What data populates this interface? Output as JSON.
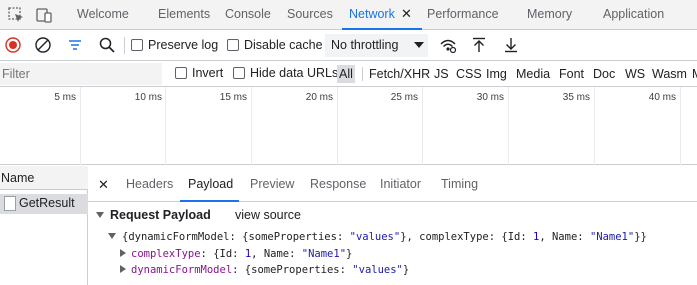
{
  "tabbar": {
    "tabs": [
      "Welcome",
      "Elements",
      "Console",
      "Sources",
      "Network",
      "Performance",
      "Memory",
      "Application"
    ],
    "active_tab": "Network",
    "close_glyph": "✕",
    "accent_color": "#1a73e8"
  },
  "toolbar": {
    "icons": [
      "record-icon",
      "clear-icon",
      "filter-icon",
      "search-icon",
      "network-conditions-icon",
      "import-har-icon",
      "export-har-icon"
    ],
    "preserve_log_label": "Preserve log",
    "disable_cache_label": "Disable cache",
    "throttling_value": "No throttling",
    "record_color": "#d93025"
  },
  "filterbar": {
    "placeholder": "Filter",
    "invert_label": "Invert",
    "hide_data_urls_label": "Hide data URLs",
    "types": [
      "All",
      "Fetch/XHR",
      "JS",
      "CSS",
      "Img",
      "Media",
      "Font",
      "Doc",
      "WS",
      "Wasm",
      "M"
    ],
    "selected_type": "All"
  },
  "timeline": {
    "ticks": [
      "5 ms",
      "10 ms",
      "15 ms",
      "20 ms",
      "25 ms",
      "30 ms",
      "35 ms",
      "40 ms"
    ]
  },
  "requests": {
    "header": "Name",
    "items": [
      "GetResult"
    ]
  },
  "detail": {
    "close_glyph": "✕",
    "tabs": [
      "Headers",
      "Payload",
      "Preview",
      "Response",
      "Initiator",
      "Timing"
    ],
    "active_tab": "Payload"
  },
  "payload": {
    "section_title": "Request Payload",
    "view_source": "view source",
    "root": {
      "open": "{",
      "key1": "dynamicFormModel",
      "sep1": ": {",
      "key2": "someProperties",
      "sep2": ": ",
      "val2": "\"values\"",
      "sep3": "}, ",
      "key3": "complexType",
      "sep4": ": {",
      "key4": "Id",
      "sep5": ": ",
      "val4": "1",
      "sep6": ", ",
      "key5": "Name",
      "sep7": ": ",
      "val5": "\"Name1\"",
      "close": "}}"
    },
    "child1": {
      "key": "complexType",
      "sep1": ": {",
      "k1": "Id",
      "s1": ": ",
      "v1": "1",
      "s2": ", ",
      "k2": "Name",
      "s3": ": ",
      "v2": "\"Name1\"",
      "close": "}"
    },
    "child2": {
      "key": "dynamicFormModel",
      "sep1": ": {",
      "k1": "someProperties",
      "s1": ": ",
      "v1": "\"values\"",
      "close": "}"
    }
  }
}
